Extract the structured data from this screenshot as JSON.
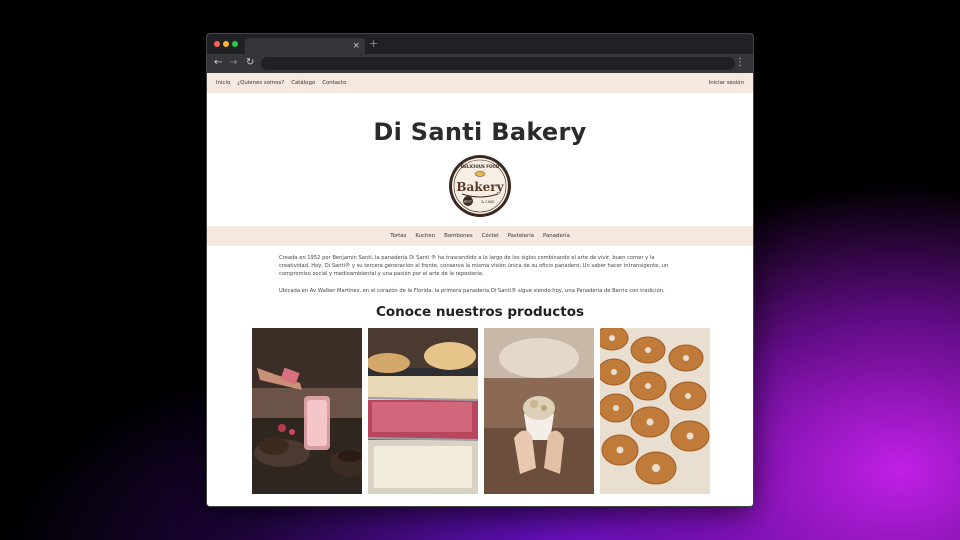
{
  "browser": {
    "tab_close": "×",
    "new_tab": "+",
    "back": "←",
    "forward": "→",
    "reload": "↻",
    "menu": "⋮"
  },
  "site": {
    "top_nav": {
      "links": [
        "Inicio",
        "¿Quienes somos?",
        "Catálogo",
        "Contacto"
      ],
      "login": "Iniciar sesión"
    },
    "brand": "Di Santi Bakery",
    "logo": {
      "arc_text": "DELICIOUS FOOD",
      "word": "Bakery",
      "sub": "& CAKE",
      "badge": "BEST",
      "icon": "bakery-logo-icon"
    },
    "category_nav": [
      "Tortas",
      "Kuchen",
      "Bombones",
      "Cóctel",
      "Pastelería",
      "Panadería"
    ],
    "about": [
      "Creada en 1952 por Benjamín Santi, la panadería Di Santi ® ha trascendido a lo largo de los siglos combinando el arte de vivir, buen comer y la creatividad. Hoy, Di Santi® y su tercera generación al frente, conserva la misma visión única de su oficio panadero: Un saber hacer intransigente, un compromiso social y medioambiental y una pasión por el arte de la repostería.",
      "Ubicada en Av Walker Martinez, en el corazón de la Florida, la primera panadería Di Santi® sigue siendo hoy, una Panadería de Barrio con tradición."
    ],
    "products_title": "Conoce nuestros productos",
    "product_images": [
      "cocktail-and-cake-photo",
      "pastry-display-photo",
      "ice-cream-cup-photo",
      "donuts-photo"
    ]
  },
  "colors": {
    "nav_background": "#f4e8df",
    "backdrop_accent": "#c020e6",
    "browser_chrome": "#35363a"
  }
}
